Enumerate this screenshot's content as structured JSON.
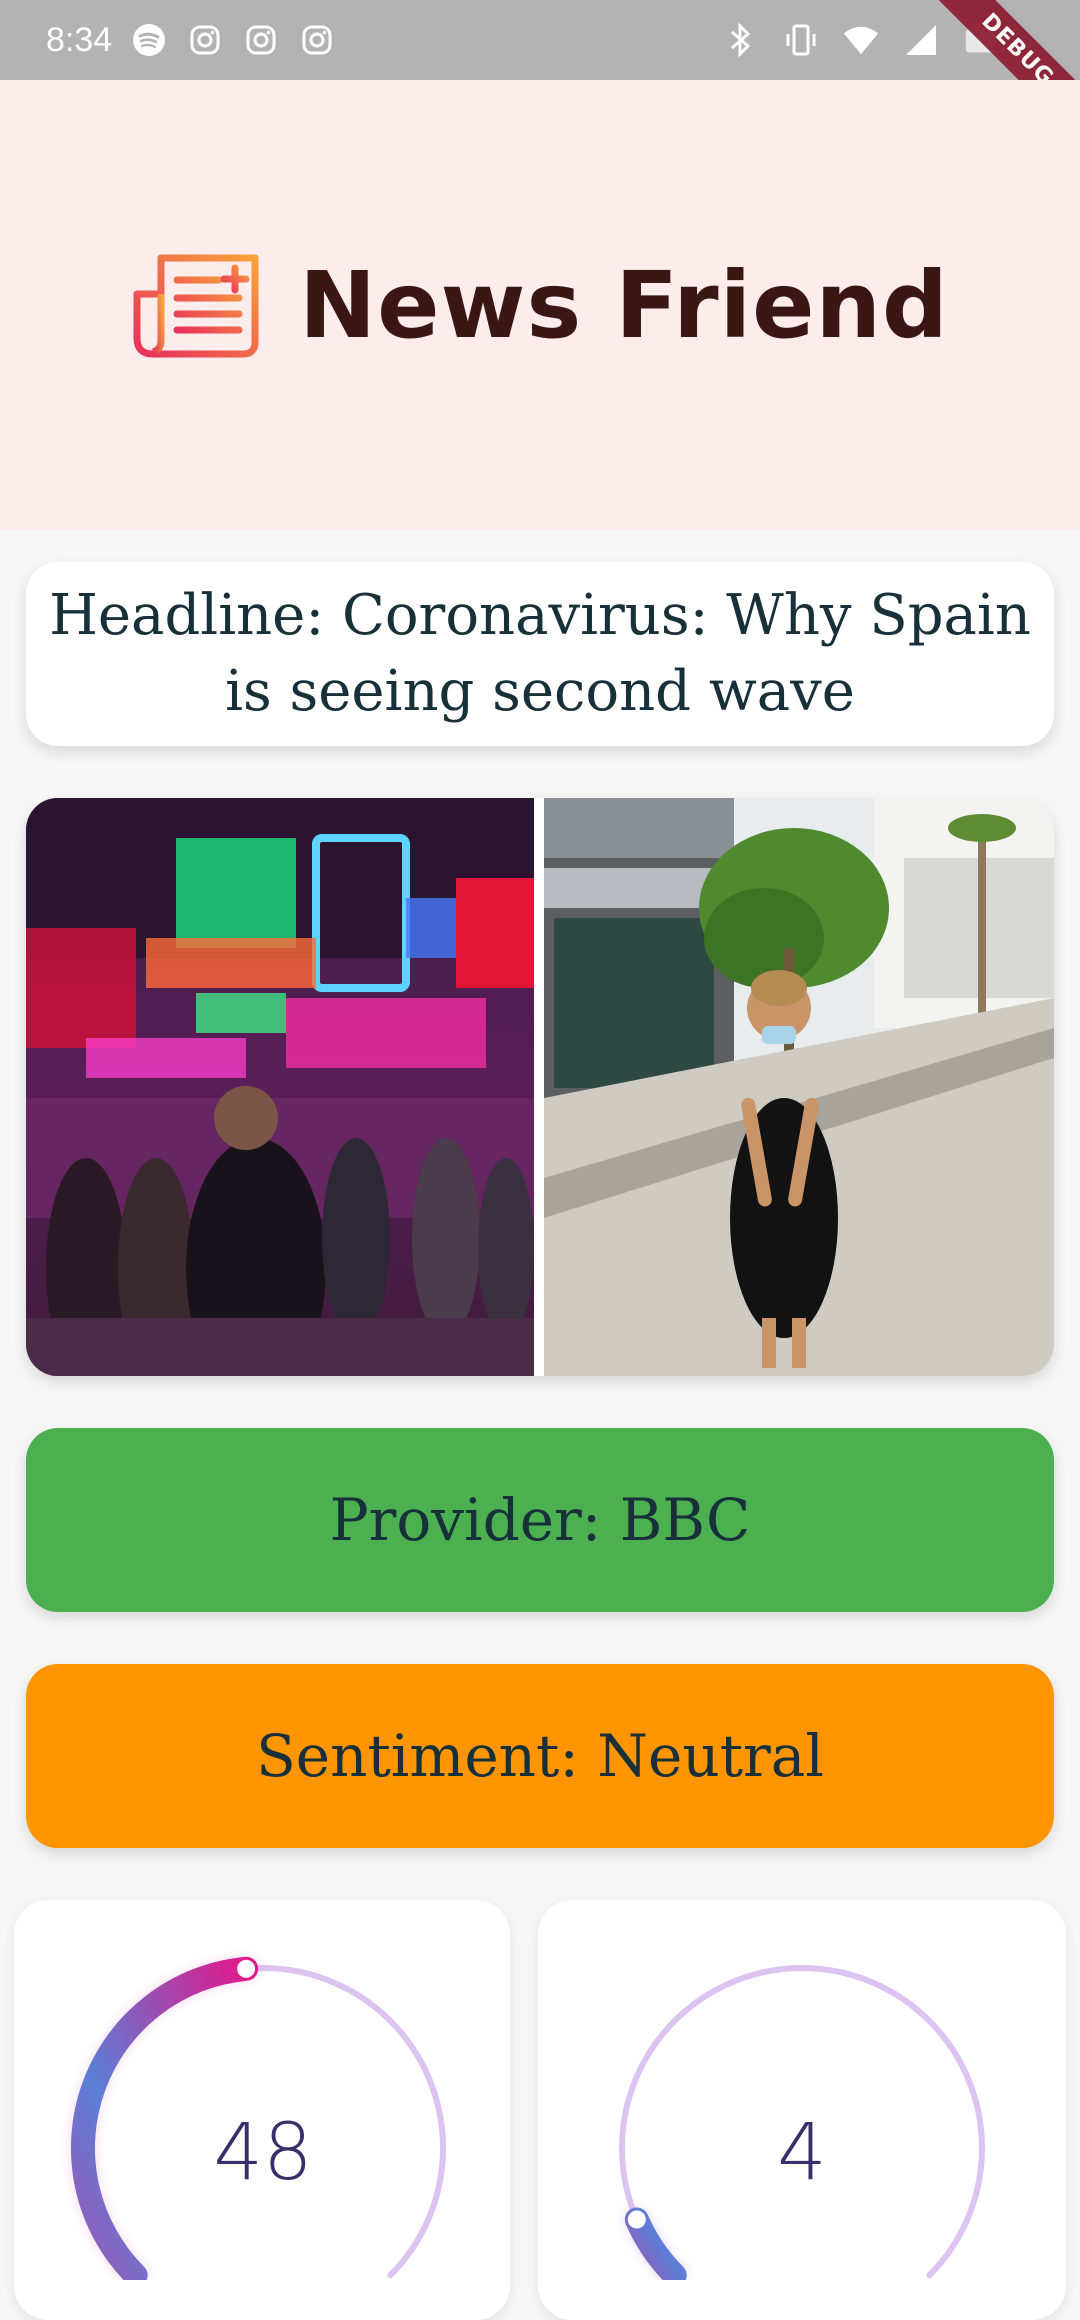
{
  "status_bar": {
    "time": "8:34",
    "apps": [
      "spotify-icon",
      "instagram-icon",
      "instagram-icon",
      "instagram-icon"
    ],
    "system": [
      "bluetooth-icon",
      "vibrate-icon",
      "wifi-icon",
      "signal-icon",
      "battery-icon"
    ],
    "debug_label": "DEBUG"
  },
  "header": {
    "title": "News Friend",
    "logo_icon": "newspaper-icon",
    "background": "#fdecec"
  },
  "article": {
    "headline": "Headline: Coronavirus: Why Spain is seeing second wave",
    "provider": "Provider: BBC",
    "sentiment": "Sentiment: Neutral",
    "provider_color": "#4caf50",
    "sentiment_color": "#ff9500"
  },
  "gauges": [
    {
      "value": "48",
      "fraction": 0.48
    },
    {
      "value": "4",
      "fraction": 0.04
    }
  ]
}
